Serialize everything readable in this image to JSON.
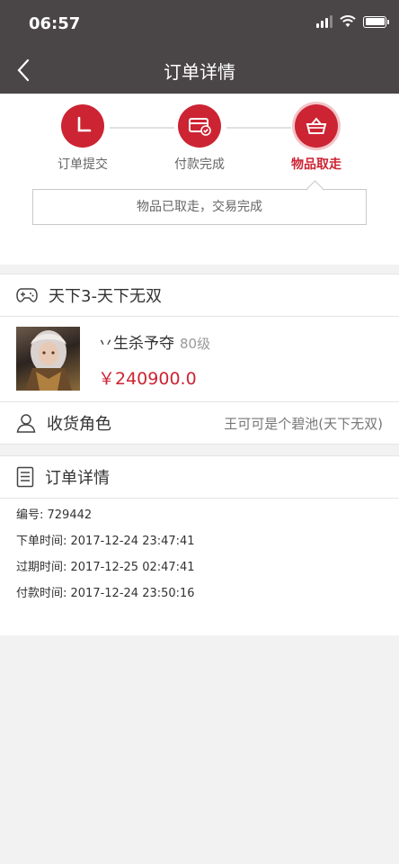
{
  "status_bar": {
    "time": "06:57"
  },
  "nav": {
    "title": "订单详情"
  },
  "progress": {
    "steps": [
      {
        "label": "订单提交",
        "icon": "clock-icon"
      },
      {
        "label": "付款完成",
        "icon": "card-paid-icon"
      },
      {
        "label": "物品取走",
        "icon": "basket-icon"
      }
    ],
    "active_step": 3,
    "notice": "物品已取走，交易完成"
  },
  "game": {
    "name": "天下3-天下无双",
    "icon": "gamepad-icon"
  },
  "product": {
    "name": "丷生杀予夺",
    "level": "80级",
    "price": "￥240900.0",
    "image": "character-avatar"
  },
  "receiver": {
    "label": "收货角色",
    "value": "王可可是个碧池(天下无双)",
    "icon": "user-icon"
  },
  "order_details": {
    "title": "订单详情",
    "icon": "document-icon",
    "lines": [
      "编号: 729442",
      "下单时间: 2017-12-24 23:47:41",
      "过期时间: 2017-12-25 02:47:41",
      "付款时间: 2017-12-24 23:50:16"
    ]
  },
  "colors": {
    "accent": "#cc2433",
    "header_bg": "#4a4547",
    "page_bg": "#f2f2f2"
  }
}
